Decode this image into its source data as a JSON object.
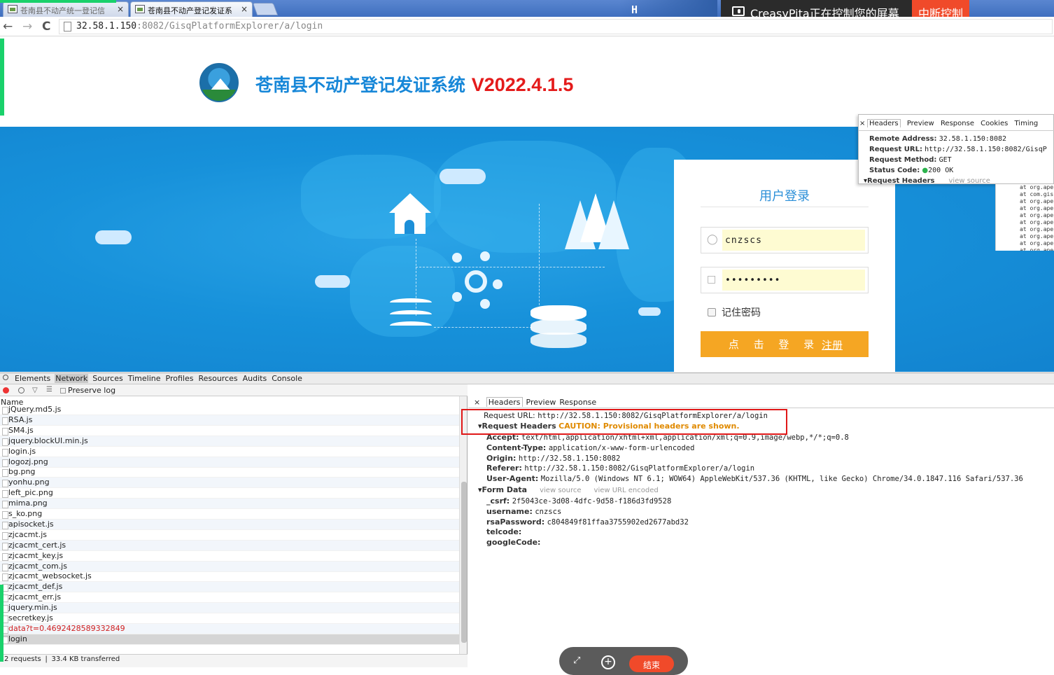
{
  "browser": {
    "tabs": [
      {
        "title": "苍南县不动产统一登记信"
      },
      {
        "title": "苍南县不动产登记发证系",
        "close": "×"
      }
    ],
    "tab_close": "×",
    "url_host": "32.58.1.150",
    "url_path": ":8082/GisqPlatformExplorer/a/login",
    "back": "←",
    "forward": "→",
    "reload": "C"
  },
  "remote_banner": {
    "message": "CreasyPita正在控制您的屏幕",
    "stop_label": "中断控制",
    "h_icon": "H"
  },
  "site": {
    "title": "苍南县不动产登记发证系统",
    "version": "V2022.4.1.5"
  },
  "login": {
    "heading": "用户登录",
    "username_value": "cnzscs",
    "password_value": "•••••••••",
    "remember_label": "记住密码",
    "submit_label": "点 击 登 录",
    "register_label": "注册",
    "user_icon": "user-icon",
    "lock_icon": "lock-icon"
  },
  "float_devtools": {
    "tabs": [
      "Headers",
      "Preview",
      "Response",
      "Cookies",
      "Timing"
    ],
    "close": "×",
    "remote_address_label": "Remote Address:",
    "remote_address_value": "32.58.1.150:8082",
    "request_url_label": "Request URL:",
    "request_url_value": "http://32.58.1.150:8082/GisqP",
    "request_method_label": "Request Method:",
    "request_method_value": "GET",
    "status_code_label": "Status Code:",
    "status_code_value": "200 OK",
    "request_headers_label": "Request Headers",
    "view_source": "view source",
    "stack_lines": [
      "at org.ape",
      "at com.gis",
      "at org.ape",
      "at org.ape",
      "at org.ape",
      "at org.ape",
      "at org.ape",
      "at org.ape",
      "at org.ape",
      "at org.ape"
    ]
  },
  "devtools": {
    "tabs": [
      "Elements",
      "Network",
      "Sources",
      "Timeline",
      "Profiles",
      "Resources",
      "Audits",
      "Console"
    ],
    "active_tab": "Network",
    "preserve_log": "Preserve log",
    "name_header": "Name",
    "files": [
      {
        "name": "jQuery.md5.js"
      },
      {
        "name": "RSA.js"
      },
      {
        "name": "SM4.js"
      },
      {
        "name": "jquery.blockUI.min.js"
      },
      {
        "name": "login.js"
      },
      {
        "name": "logozj.png"
      },
      {
        "name": "bg.png"
      },
      {
        "name": "yonhu.png"
      },
      {
        "name": "left_pic.png"
      },
      {
        "name": "mima.png"
      },
      {
        "name": "s_ko.png"
      },
      {
        "name": "apisocket.js"
      },
      {
        "name": "zjcacmt.js"
      },
      {
        "name": "zjcacmt_cert.js"
      },
      {
        "name": "zjcacmt_key.js"
      },
      {
        "name": "zjcacmt_com.js"
      },
      {
        "name": "zjcacmt_websocket.js"
      },
      {
        "name": "zjcacmt_def.js"
      },
      {
        "name": "zjcacmt_err.js"
      },
      {
        "name": "jquery.min.js"
      },
      {
        "name": "secretkey.js"
      },
      {
        "name": "data?t=0.4692428589332849",
        "error": true
      },
      {
        "name": "login",
        "selected": true
      }
    ],
    "status": "2 requests  ❘  33.4 KB transferred",
    "detail_tabs": [
      "Headers",
      "Preview",
      "Response"
    ],
    "detail_close": "×",
    "request_url_label": "Request URL:",
    "request_url_value": "http://32.58.1.150:8082/GisqPlatformExplorer/a/login",
    "request_headers_label": "Request Headers",
    "caution": "CAUTION: Provisional headers are shown.",
    "headers": [
      {
        "k": "Accept:",
        "v": "text/html,application/xhtml+xml,application/xml;q=0.9,image/webp,*/*;q=0.8"
      },
      {
        "k": "Content-Type:",
        "v": "application/x-www-form-urlencoded"
      },
      {
        "k": "Origin:",
        "v": "http://32.58.1.150:8082"
      },
      {
        "k": "Referer:",
        "v": "http://32.58.1.150:8082/GisqPlatformExplorer/a/login"
      },
      {
        "k": "User-Agent:",
        "v": "Mozilla/5.0 (Windows NT 6.1; WOW64) AppleWebKit/537.36 (KHTML, like Gecko) Chrome/34.0.1847.116 Safari/537.36"
      }
    ],
    "form_data_label": "Form Data",
    "form_view_source": "view source",
    "form_view_url": "view URL encoded",
    "form_fields": [
      {
        "k": "_csrf:",
        "v": "2f5043ce-3d08-4dfc-9d58-f186d3fd9528"
      },
      {
        "k": "username:",
        "v": "cnzscs"
      },
      {
        "k": "rsaPassword:",
        "v": "c804849f81ffaa3755902ed2677abd32"
      },
      {
        "k": "telcode:",
        "v": ""
      },
      {
        "k": "googleCode:",
        "v": ""
      }
    ]
  },
  "controller": {
    "end_label": "结束",
    "expand_icon": "expand-icon",
    "zoom_icon": "zoom-in-icon"
  },
  "colors": {
    "brand_blue": "#1787d8",
    "version_red": "#e41b1b",
    "login_orange": "#f5a623",
    "highlight_red": "#e01818",
    "remote_stop": "#f04a2a"
  }
}
